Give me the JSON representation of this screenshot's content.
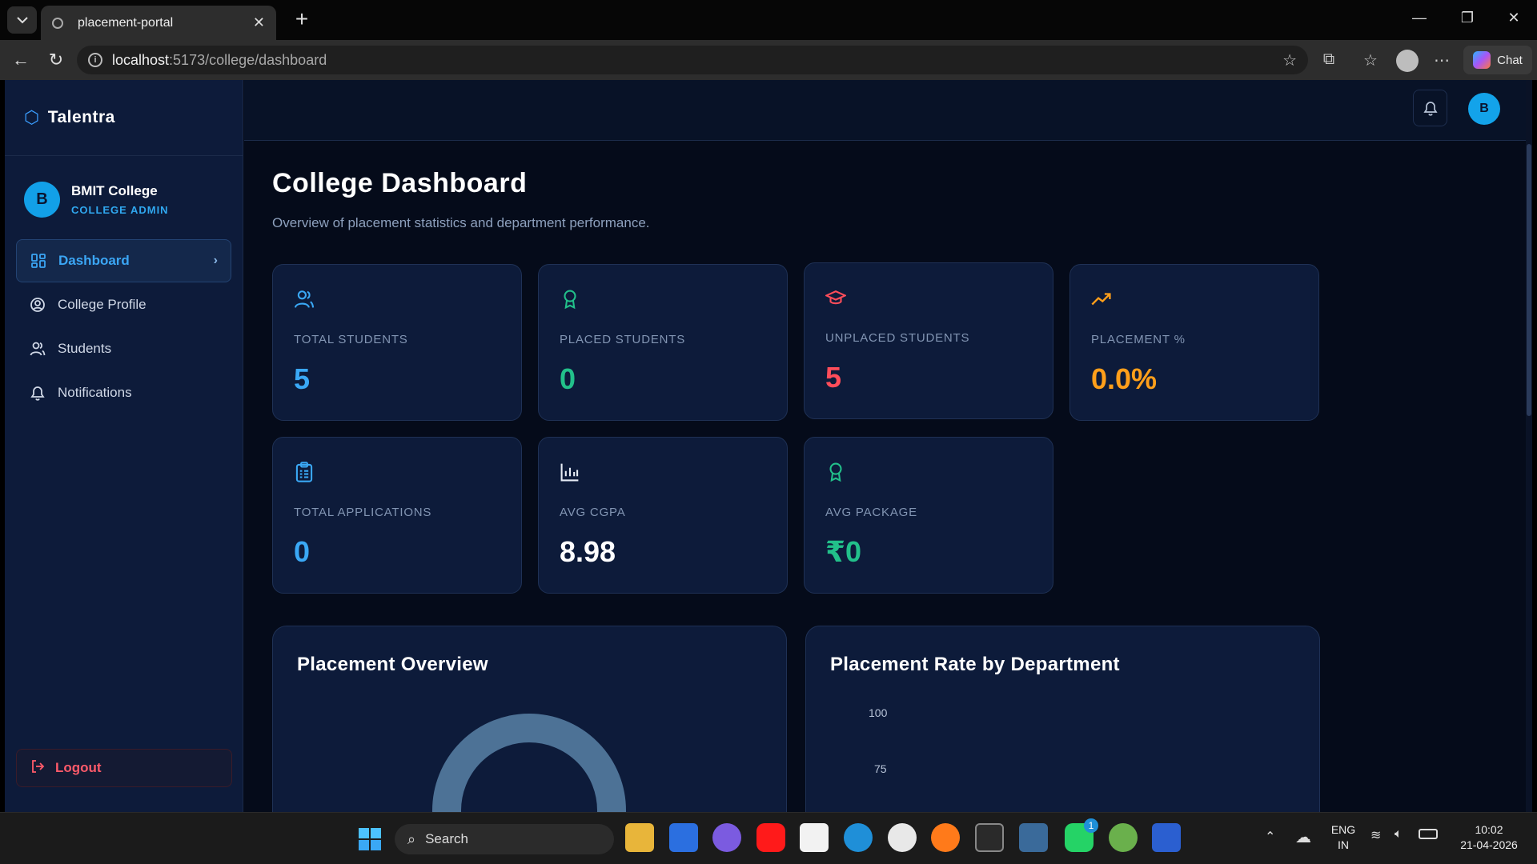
{
  "browser": {
    "tab_title": "placement-portal",
    "url_host": "localhost",
    "url_path": ":5173/college/dashboard",
    "chat_label": "Chat"
  },
  "app": {
    "brand": "Talentra",
    "college": {
      "avatar_letter": "B",
      "name": "BMIT College",
      "role": "COLLEGE ADMIN"
    },
    "menu": [
      {
        "label": "Dashboard",
        "icon": "dashboard-icon",
        "active": true
      },
      {
        "label": "College Profile",
        "icon": "profile-icon",
        "active": false
      },
      {
        "label": "Students",
        "icon": "users-icon",
        "active": false
      },
      {
        "label": "Notifications",
        "icon": "bell-icon",
        "active": false
      }
    ],
    "logout_label": "Logout",
    "user_avatar_letter": "B"
  },
  "dashboard": {
    "title": "College Dashboard",
    "subtitle": "Overview of placement statistics and department performance.",
    "stats": [
      {
        "label": "TOTAL STUDENTS",
        "value": "5",
        "icon": "users-icon",
        "color": "#3aa8f5"
      },
      {
        "label": "PLACED STUDENTS",
        "value": "0",
        "icon": "award-icon",
        "color": "#22c08a"
      },
      {
        "label": "UNPLACED STUDENTS",
        "value": "5",
        "icon": "graduation-cap-icon",
        "color": "#ff4d5a"
      },
      {
        "label": "PLACEMENT %",
        "value": "0.0%",
        "icon": "trending-up-icon",
        "color": "#ff9f1a"
      },
      {
        "label": "TOTAL APPLICATIONS",
        "value": "0",
        "icon": "clipboard-icon",
        "color": "#3aa8f5"
      },
      {
        "label": "AVG CGPA",
        "value": "8.98",
        "icon": "bar-chart-icon",
        "color": "#ffffff"
      },
      {
        "label": "AVG PACKAGE",
        "value": "₹0",
        "icon": "award-icon",
        "color": "#22c08a"
      }
    ],
    "placement_overview": {
      "title": "Placement Overview"
    },
    "dept_chart": {
      "title": "Placement Rate by Department",
      "y_ticks": [
        "100",
        "75"
      ]
    }
  },
  "taskbar": {
    "search_label": "Search",
    "lang_top": "ENG",
    "lang_bottom": "IN",
    "time": "10:02",
    "date": "21-04-2026",
    "whatsapp_badge": "1"
  },
  "colors": {
    "accent": "#3aa8f5",
    "success": "#22c08a",
    "danger": "#ff4d5a",
    "warning": "#ff9f1a",
    "donut": "#4d7296"
  }
}
